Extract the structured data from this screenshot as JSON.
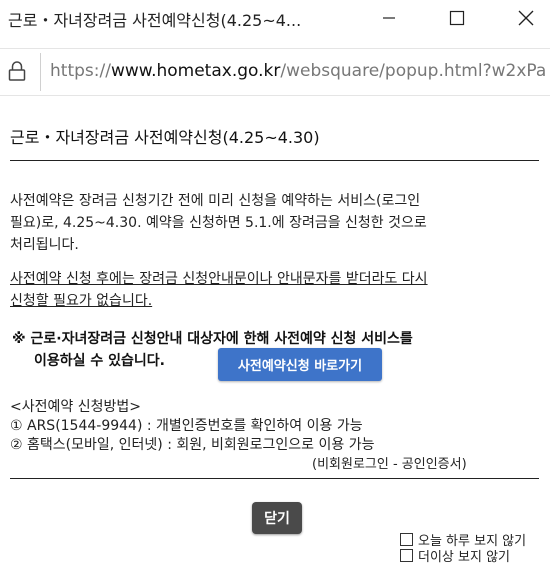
{
  "window": {
    "title": "근로・자녀장려금 사전예약신청(4.25~4...",
    "minimize_icon": "minimize-icon",
    "maximize_icon": "maximize-icon",
    "close_icon": "close-icon"
  },
  "address_bar": {
    "lock_icon": "lock-icon",
    "url_scheme": "https://",
    "url_host": "www.hometax.go.kr",
    "url_path": "/websquare/popup.html?w2xPa"
  },
  "popup": {
    "title": "근로・자녀장려금 사전예약신청(4.25~4.30)",
    "intro_line1": "사전예약은 장려금 신청기간 전에 미리 신청을 예약하는 서비스(로그인",
    "intro_line2": "필요)로, 4.25~4.30. 예약을 신청하면 5.1.에 장려금을 신청한 것으로",
    "intro_line3": "처리됩니다.",
    "underline_line1": "사전예약 신청 후에는 장려금 신청안내문이나 안내문자를 받더라도 다시",
    "underline_line2": "신청할 필요가 없습니다.",
    "notice_line1": "※ 근로·자녀장려금 신청안내 대상자에 한해 사전예약 신청 서비스를",
    "notice_line2": "이용하실 수 있습니다.",
    "goto_button": "사전예약신청 바로가기",
    "method_heading": "<사전예약 신청방법>",
    "method_1": "① ARS(1544-9944) : 개별인증번호를 확인하여 이용 가능",
    "method_2": "② 홈택스(모바일, 인터넷) : 회원, 비회원로그인으로 이용 가능",
    "method_2_note": "(비회원로그인 - 공인인증서)",
    "close_button": "닫기",
    "checkbox_today": "오늘 하루 보지 않기",
    "checkbox_never": "더이상 보지 않기"
  }
}
